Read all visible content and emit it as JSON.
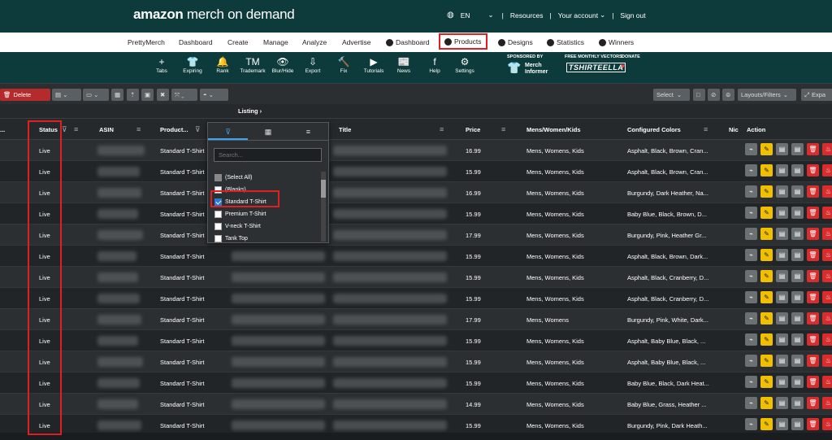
{
  "header": {
    "logo_main": "amazon",
    "logo_rest": " merch on demand",
    "lang": "EN",
    "resources": "Resources",
    "account": "Your account",
    "signout": "Sign out"
  },
  "nav": {
    "items": [
      "PrettyMerch",
      "Dashboard",
      "Create",
      "Manage",
      "Analyze",
      "Advertise"
    ],
    "pm_items": [
      "Dashboard",
      "Products",
      "Designs",
      "Statistics",
      "Winners"
    ]
  },
  "tools": [
    {
      "label": "Tabs",
      "icon": "+"
    },
    {
      "label": "Expiring",
      "icon": "👕"
    },
    {
      "label": "Rank",
      "icon": "🔔"
    },
    {
      "label": "Trademark",
      "icon": "TM"
    },
    {
      "label": "Blur/Hide",
      "icon": "👁"
    },
    {
      "label": "Export",
      "icon": "⇩"
    },
    {
      "label": "Fix",
      "icon": "🔨"
    },
    {
      "label": "Tutorials",
      "icon": "▶"
    },
    {
      "label": "News",
      "icon": "📰"
    },
    {
      "label": "Help",
      "icon": "f"
    },
    {
      "label": "Settings",
      "icon": "⚙"
    }
  ],
  "sponsors": {
    "sponsored": "SPONSORED BY",
    "merch1": "Merch",
    "merch2": "Informer",
    "vectors": "FREE MONTHLY VECTORS",
    "shirt": "TSHIRTEELLA",
    "donate": "DONATE"
  },
  "toolbar": {
    "delete": "Delete",
    "select": "Select",
    "layouts": "Layouts/Filters",
    "expand": "Expa"
  },
  "grid": {
    "group_label": "Listing ›",
    "headers": {
      "status": "Status",
      "asin": "ASIN",
      "product": "Product...",
      "title": "Title",
      "price": "Price",
      "mwk": "Mens/Women/Kids",
      "colors": "Configured Colors",
      "nic": "Nic",
      "action": "Action",
      "left": "..."
    },
    "rows": [
      {
        "status": "Live",
        "product": "Standard T-Shirt",
        "price": "16.99",
        "mwk": "Mens, Womens, Kids",
        "colors": "Asphalt, Black, Brown, Cran..."
      },
      {
        "status": "Live",
        "product": "Standard T-Shirt",
        "price": "15.99",
        "mwk": "Mens, Womens, Kids",
        "colors": "Asphalt, Black, Brown, Cran..."
      },
      {
        "status": "Live",
        "product": "Standard T-Shirt",
        "price": "16.99",
        "mwk": "Mens, Womens, Kids",
        "colors": "Burgundy, Dark Heather, Na..."
      },
      {
        "status": "Live",
        "product": "Standard T-Shirt",
        "price": "15.99",
        "mwk": "Mens, Womens, Kids",
        "colors": "Baby Blue, Black, Brown, D..."
      },
      {
        "status": "Live",
        "product": "Standard T-Shirt",
        "price": "17.99",
        "mwk": "Mens, Womens, Kids",
        "colors": "Burgundy, Pink, Heather Gr..."
      },
      {
        "status": "Live",
        "product": "Standard T-Shirt",
        "price": "15.99",
        "mwk": "Mens, Womens, Kids",
        "colors": "Asphalt, Black, Brown, Dark..."
      },
      {
        "status": "Live",
        "product": "Standard T-Shirt",
        "price": "15.99",
        "mwk": "Mens, Womens, Kids",
        "colors": "Asphalt, Black, Cranberry, D..."
      },
      {
        "status": "Live",
        "product": "Standard T-Shirt",
        "price": "15.99",
        "mwk": "Mens, Womens, Kids",
        "colors": "Asphalt, Black, Cranberry, D..."
      },
      {
        "status": "Live",
        "product": "Standard T-Shirt",
        "price": "17.99",
        "mwk": "Mens, Womens",
        "colors": "Burgundy, Pink, White, Dark..."
      },
      {
        "status": "Live",
        "product": "Standard T-Shirt",
        "price": "15.99",
        "mwk": "Mens, Womens, Kids",
        "colors": "Asphalt, Baby Blue, Black, ..."
      },
      {
        "status": "Live",
        "product": "Standard T-Shirt",
        "price": "15.99",
        "mwk": "Mens, Womens, Kids",
        "colors": "Asphalt, Baby Blue, Black, ..."
      },
      {
        "status": "Live",
        "product": "Standard T-Shirt",
        "price": "15.99",
        "mwk": "Mens, Womens, Kids",
        "colors": "Baby Blue, Black, Dark Heat..."
      },
      {
        "status": "Live",
        "product": "Standard T-Shirt",
        "price": "14.99",
        "mwk": "Mens, Womens, Kids",
        "colors": "Baby Blue, Grass, Heather ..."
      },
      {
        "status": "Live",
        "product": "Standard T-Shirt",
        "price": "15.99",
        "mwk": "Mens, Womens, Kids",
        "colors": "Burgundy, Pink, Dark Heath..."
      }
    ]
  },
  "filter": {
    "search_placeholder": "Search...",
    "options": [
      {
        "label": "(Select All)",
        "state": "partial"
      },
      {
        "label": "(Blanks)",
        "state": "off"
      },
      {
        "label": "Standard T-Shirt",
        "state": "on"
      },
      {
        "label": "Premium T-Shirt",
        "state": "off"
      },
      {
        "label": "V-neck T-Shirt",
        "state": "off"
      },
      {
        "label": "Tank Top",
        "state": "off"
      }
    ]
  }
}
